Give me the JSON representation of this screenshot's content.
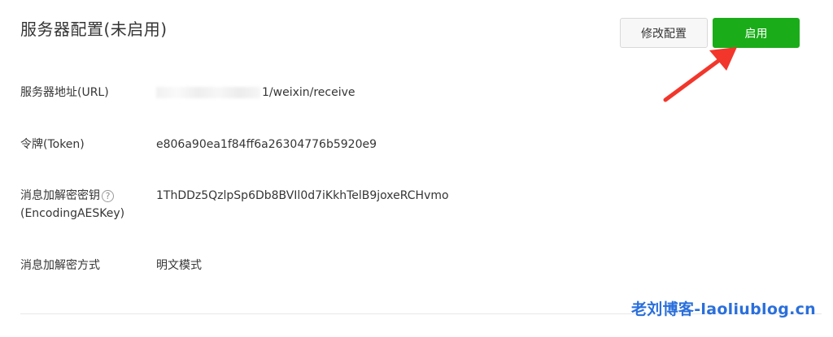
{
  "header": {
    "title": "服务器配置(未启用)",
    "edit_button": "修改配置",
    "enable_button": "启用"
  },
  "rows": [
    {
      "label": "服务器地址(URL)",
      "value": "1/weixin/receive",
      "value_redacted": true
    },
    {
      "label": "令牌(Token)",
      "value": "e806a90ea1f84ff6a26304776b5920e9"
    },
    {
      "label_line1": "消息加解密密钥",
      "label_line2": "(EncodingAESKey)",
      "value": "1ThDDz5QzlpSp6Db8BVIl0d7iKkhTelB9joxeRCHvmo"
    },
    {
      "label": "消息加解密方式",
      "value": "明文模式"
    }
  ],
  "help_icon": {
    "name": "help-icon",
    "glyph": "?"
  },
  "watermark": "老刘博客-laoliublog.cn",
  "colors": {
    "accent_green": "#1aad19",
    "arrow_red": "#f2362b",
    "watermark_blue": "#2a6fdb"
  }
}
